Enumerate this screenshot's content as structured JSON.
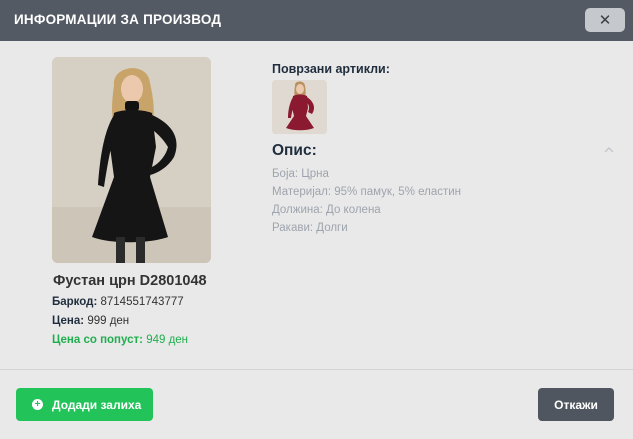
{
  "header": {
    "title": "ИНФОРМАЦИИ ЗА ПРОИЗВОД",
    "close_symbol": "✕"
  },
  "product": {
    "name": "Фустан црн D2801048",
    "barcode_label": "Баркод:",
    "barcode_value": "8714551743777",
    "price_label": "Цена:",
    "price_value": "999 ден",
    "discount_label": "Цена со попуст:",
    "discount_value": "949 ден"
  },
  "related": {
    "title": "Поврзани артикли:"
  },
  "description": {
    "title": "Опис:",
    "lines": [
      "Боја: Црна",
      "Материјал: 95% памук, 5% еластин",
      "Должина: До колена",
      "Ракави: Долги"
    ]
  },
  "footer": {
    "add_label": "Додади залиха",
    "cancel_label": "Откажи"
  },
  "colors": {
    "header_bg": "#535a64",
    "accent_green": "#22c45a",
    "cancel_bg": "#50565f",
    "dress_black": "#151515",
    "dress_burgundy": "#8b1a30"
  }
}
